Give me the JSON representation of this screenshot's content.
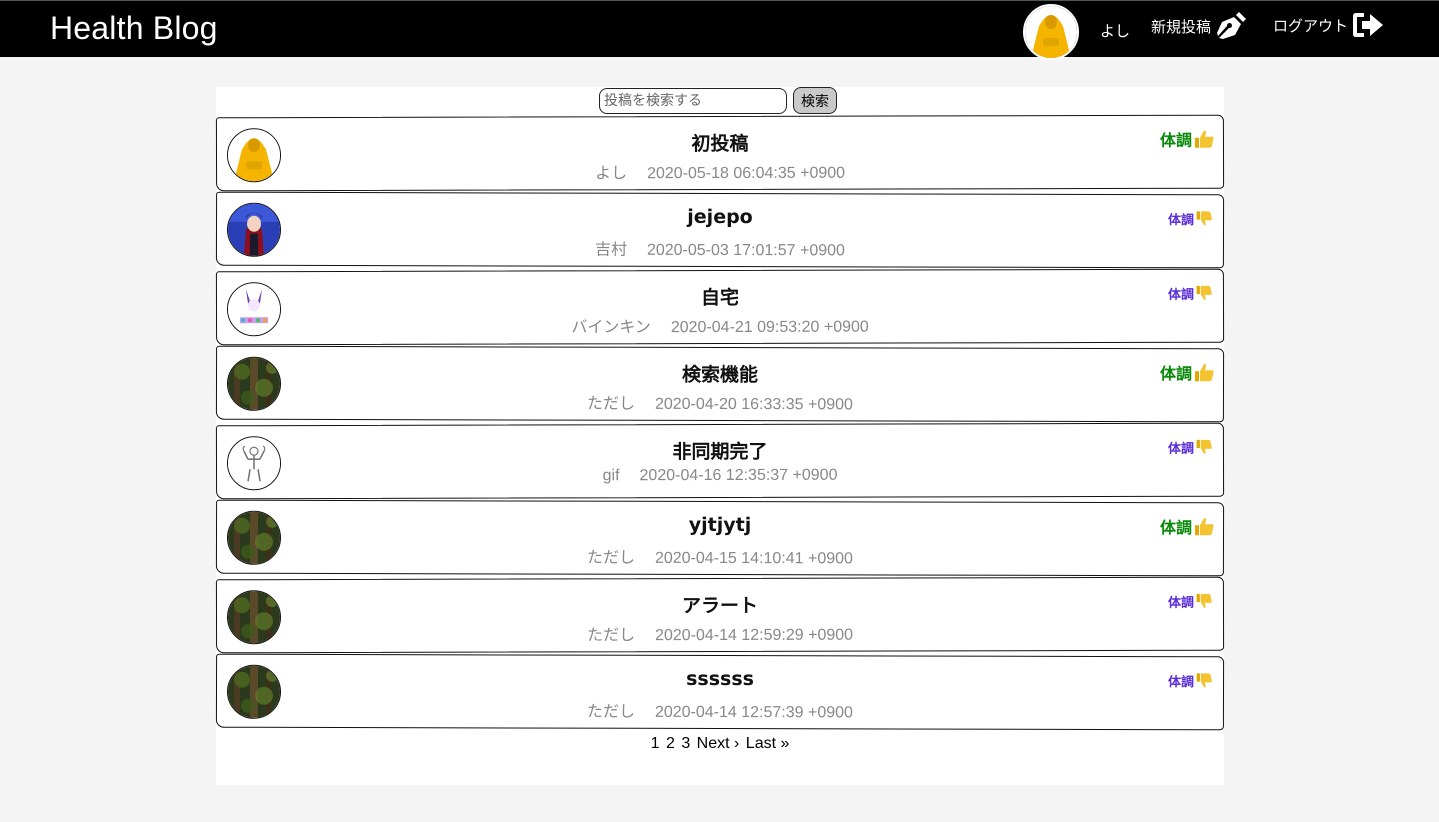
{
  "header": {
    "brand": "Health Blog",
    "username": "よし",
    "new_post_label": "新規投稿",
    "logout_label": "ログアウト"
  },
  "search": {
    "placeholder": "投稿を検索する",
    "value": "",
    "button_label": "検索"
  },
  "posts": [
    {
      "title": "初投稿",
      "author": "よし",
      "timestamp": "2020-05-18 06:04:35 +0900",
      "condition_label": "体調",
      "condition": "good",
      "avatar": "yellow-hoodie"
    },
    {
      "title": "jejepo",
      "author": "吉村",
      "timestamp": "2020-05-03 17:01:57 +0900",
      "condition_label": "体調",
      "condition": "bad",
      "avatar": "anime-character"
    },
    {
      "title": "自宅",
      "author": "バインキン",
      "timestamp": "2020-04-21 09:53:20 +0900",
      "condition_label": "体調",
      "condition": "bad",
      "avatar": "illustration"
    },
    {
      "title": "検索機能",
      "author": "ただし",
      "timestamp": "2020-04-20 16:33:35 +0900",
      "condition_label": "体調",
      "condition": "good",
      "avatar": "forest"
    },
    {
      "title": "非同期完了",
      "author": "gif",
      "timestamp": "2020-04-16 12:35:37 +0900",
      "condition_label": "体調",
      "condition": "bad",
      "avatar": "sketch"
    },
    {
      "title": "yjtjytj",
      "author": "ただし",
      "timestamp": "2020-04-15 14:10:41 +0900",
      "condition_label": "体調",
      "condition": "good",
      "avatar": "forest"
    },
    {
      "title": "アラート",
      "author": "ただし",
      "timestamp": "2020-04-14 12:59:29 +0900",
      "condition_label": "体調",
      "condition": "bad",
      "avatar": "forest"
    },
    {
      "title": "ssssss",
      "author": "ただし",
      "timestamp": "2020-04-14 12:57:39 +0900",
      "condition_label": "体調",
      "condition": "bad",
      "avatar": "forest"
    }
  ],
  "condition_icons": {
    "good": "thumbs-up-icon",
    "bad": "thumbs-down-icon"
  },
  "colors": {
    "good": "#0a8a0a",
    "bad": "#5a2dd8",
    "thumb": "#f4c430"
  },
  "pagination": {
    "pages": [
      "1",
      "2",
      "3"
    ],
    "next_label": "Next ›",
    "last_label": "Last »"
  }
}
